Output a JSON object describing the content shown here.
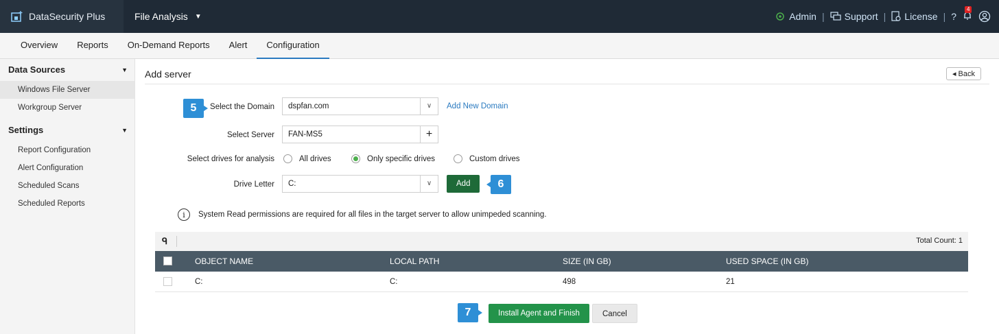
{
  "app": {
    "brand": "DataSecurity Plus",
    "module": "File Analysis"
  },
  "topright": {
    "admin": "Admin",
    "support": "Support",
    "license": "License",
    "help": "?",
    "notif_count": "4"
  },
  "tabs": [
    "Overview",
    "Reports",
    "On-Demand Reports",
    "Alert",
    "Configuration"
  ],
  "active_tab": "Configuration",
  "sidebar": {
    "section1": "Data Sources",
    "section1_items": [
      "Windows File Server",
      "Workgroup Server"
    ],
    "section2": "Settings",
    "section2_items": [
      "Report Configuration",
      "Alert Configuration",
      "Scheduled Scans",
      "Scheduled Reports"
    ]
  },
  "page": {
    "title": "Add server",
    "back": "Back"
  },
  "form": {
    "domain_label": "Select the Domain",
    "domain_value": "dspfan.com",
    "add_domain": "Add New Domain",
    "server_label": "Select Server",
    "server_value": "FAN-MS5",
    "drives_label": "Select drives for analysis",
    "radio_all": "All drives",
    "radio_specific": "Only specific drives",
    "radio_custom": "Custom drives",
    "drive_label": "Drive Letter",
    "drive_value": "C:",
    "add_button": "Add"
  },
  "steps": {
    "s5": "5",
    "s6": "6",
    "s7": "7"
  },
  "info_text": "System Read permissions are required for all files in the target server to allow unimpeded scanning.",
  "table": {
    "total": "Total Count: 1",
    "headers": [
      "OBJECT NAME",
      "LOCAL PATH",
      "SIZE (IN GB)",
      "USED SPACE (IN GB)"
    ],
    "rows": [
      [
        "C:",
        "C:",
        "498",
        "21"
      ]
    ]
  },
  "actions": {
    "install": "Install Agent and Finish",
    "cancel": "Cancel"
  },
  "colors": {
    "topbar": "#1f2a36",
    "accent": "#2a7ac0",
    "step": "#2e8fd6",
    "add": "#1e6a38",
    "install": "#23934a",
    "thead": "#4a5a66"
  }
}
